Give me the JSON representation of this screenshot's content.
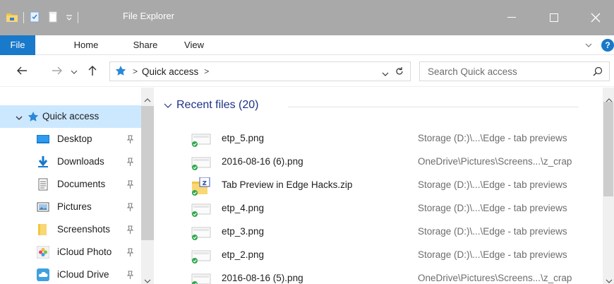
{
  "window": {
    "title": "File Explorer"
  },
  "ribbon": {
    "tabs": [
      {
        "label": "File"
      },
      {
        "label": "Home"
      },
      {
        "label": "Share"
      },
      {
        "label": "View"
      }
    ],
    "help_label": "?"
  },
  "address": {
    "crumb": "Quick access",
    "separator": ">",
    "search_placeholder": "Search Quick access"
  },
  "nav": {
    "quick_access": "Quick access",
    "items": [
      {
        "label": "Desktop",
        "icon": "desktop-icon"
      },
      {
        "label": "Downloads",
        "icon": "downloads-icon"
      },
      {
        "label": "Documents",
        "icon": "documents-icon"
      },
      {
        "label": "Pictures",
        "icon": "pictures-icon"
      },
      {
        "label": "Screenshots",
        "icon": "folder-icon"
      },
      {
        "label": "iCloud Photo",
        "icon": "icloud-photos-icon"
      },
      {
        "label": "iCloud Drive",
        "icon": "icloud-drive-icon"
      }
    ]
  },
  "recent": {
    "title": "Recent files (20)",
    "files": [
      {
        "name": "etp_5.png",
        "location": "Storage (D:)\\...\\Edge - tab previews",
        "icon": "image-file-icon"
      },
      {
        "name": "2016-08-16 (6).png",
        "location": "OneDrive\\Pictures\\Screens...\\z_crap",
        "icon": "image-file-icon"
      },
      {
        "name": "Tab Preview in Edge Hacks.zip",
        "location": "Storage (D:)\\...\\Edge - tab previews",
        "icon": "zip-folder-icon"
      },
      {
        "name": "etp_4.png",
        "location": "Storage (D:)\\...\\Edge - tab previews",
        "icon": "image-file-icon"
      },
      {
        "name": "etp_3.png",
        "location": "Storage (D:)\\...\\Edge - tab previews",
        "icon": "image-file-icon"
      },
      {
        "name": "etp_2.png",
        "location": "Storage (D:)\\...\\Edge - tab previews",
        "icon": "image-file-icon"
      },
      {
        "name": "2016-08-16 (5).png",
        "location": "OneDrive\\Pictures\\Screens...\\z_crap",
        "icon": "image-file-icon"
      }
    ]
  },
  "colors": {
    "titlebar": "#a9a9a9",
    "file_tab": "#1979ca",
    "selected": "#cce8ff",
    "group_title": "#1e3287",
    "location_text": "#6d6d6d"
  }
}
